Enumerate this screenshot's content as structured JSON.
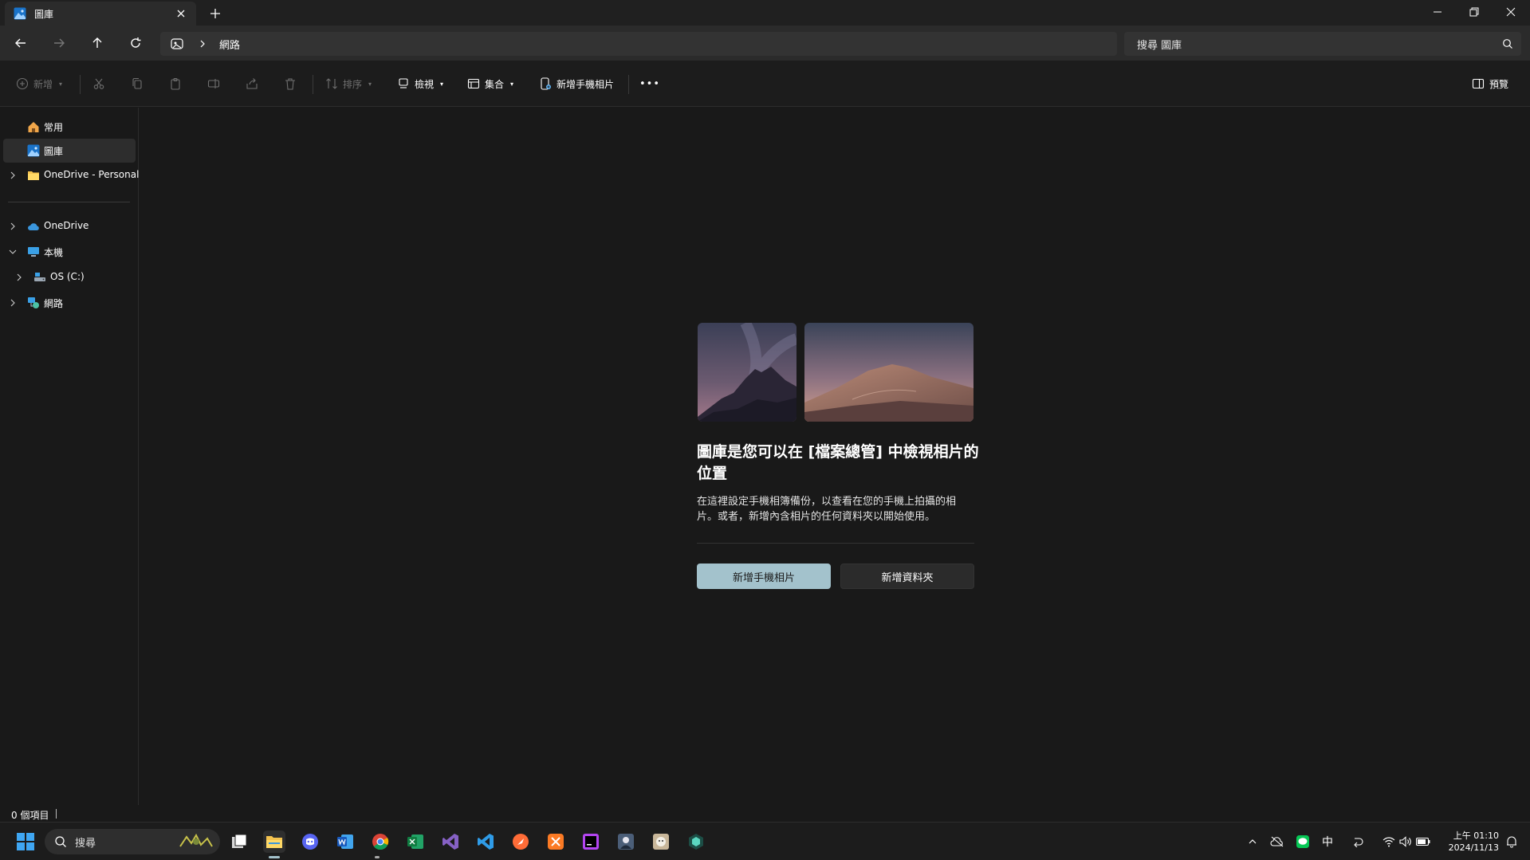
{
  "window": {
    "tab_title": "圖庫",
    "new_tab": "+"
  },
  "address": {
    "breadcrumb": "網路",
    "search_placeholder": "搜尋 圖庫"
  },
  "commandbar": {
    "new_label": "新增",
    "sort_label": "排序",
    "view_label": "檢視",
    "collection_label": "集合",
    "add_phone_photos_label": "新增手機相片",
    "more": "•••",
    "preview_label": "預覽"
  },
  "sidebar": {
    "items": [
      {
        "label": "常用",
        "icon": "home-icon"
      },
      {
        "label": "圖庫",
        "icon": "gallery-icon"
      },
      {
        "label": "OneDrive - Personal",
        "icon": "folder-icon"
      },
      {
        "label": "OneDrive",
        "icon": "cloud-icon"
      },
      {
        "label": "本機",
        "icon": "computer-icon"
      },
      {
        "label": "OS (C:)",
        "icon": "drive-icon"
      },
      {
        "label": "網路",
        "icon": "network-icon"
      }
    ]
  },
  "empty_state": {
    "title": "圖庫是您可以在 [檔案總管] 中檢視相片的位置",
    "description": "在這裡設定手機相簿備份，以查看在您的手機上拍攝的相片。或者，新增內含相片的任何資料夾以開始使用。",
    "primary_button": "新增手機相片",
    "secondary_button": "新增資料夾"
  },
  "status": {
    "item_count": "0 個項目"
  },
  "taskbar": {
    "search_placeholder": "搜尋",
    "ime": "中",
    "time": "上午 01:10",
    "date": "2024/11/13"
  },
  "colors": {
    "accent": "#a3c2cc",
    "background": "#191919",
    "panel": "#2b2b2b"
  }
}
